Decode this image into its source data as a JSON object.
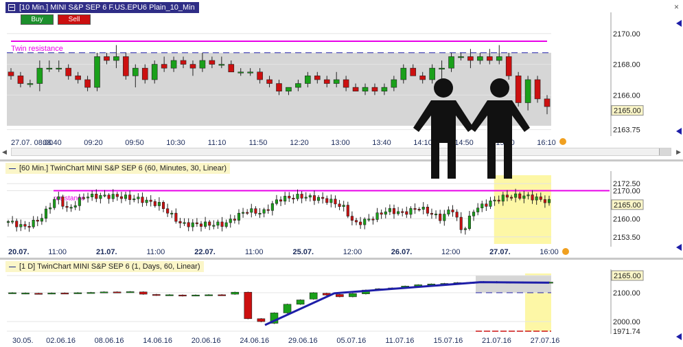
{
  "window": {
    "title": "[10 Min.] MINI S&P SEP 6   F.US.EPU6 Plain_10_Min",
    "buy_label": "Buy",
    "sell_label": "Sell",
    "close_glyph": "×"
  },
  "colors": {
    "bull": "#1aa01a",
    "bear": "#cc1010",
    "resistance": "#e800e8",
    "trendline": "#1e1ea8",
    "dashed": "#1e1ea8",
    "highlight": "#fdf7a6",
    "zone": "#d6d6d6"
  },
  "chart_data": [
    {
      "name": "pane-10min",
      "type": "candlestick",
      "ylim": [
        2163.6,
        2171.2
      ],
      "y_ticks": [
        2170.0,
        2168.0,
        2166.0,
        2163.75
      ],
      "y_tick_labels": [
        "2170.00",
        "2168.00",
        "2166.00",
        "2163.75"
      ],
      "current_price": "2165.00",
      "x_tick_labels": [
        "27.07. 08:00",
        "08:40",
        "09:20",
        "09:50",
        "10:30",
        "11:10",
        "11:50",
        "12:20",
        "13:00",
        "13:40",
        "14:10",
        "14:50",
        "15:30",
        "16:10"
      ],
      "annotations": [
        {
          "text": "Twin resistance",
          "y": 2169.5
        }
      ],
      "resistance_line": 2169.5,
      "dashed_line": 2168.75,
      "zone": [
        2164.0,
        2168.75
      ],
      "candles": [
        [
          2167.5,
          2167.75,
          2167.0,
          2167.25
        ],
        [
          2167.25,
          2167.5,
          2166.5,
          2166.75
        ],
        [
          2166.75,
          2167.0,
          2166.5,
          2166.75
        ],
        [
          2166.75,
          2168.25,
          2166.25,
          2167.75
        ],
        [
          2167.75,
          2168.25,
          2167.5,
          2167.75
        ],
        [
          2167.75,
          2168.25,
          2167.5,
          2167.75
        ],
        [
          2167.75,
          2168.0,
          2167.0,
          2167.25
        ],
        [
          2167.25,
          2167.5,
          2166.75,
          2167.0
        ],
        [
          2167.0,
          2167.25,
          2166.25,
          2166.5
        ],
        [
          2166.5,
          2168.75,
          2166.25,
          2168.5
        ],
        [
          2168.5,
          2168.75,
          2168.0,
          2168.25
        ],
        [
          2168.25,
          2169.25,
          2167.75,
          2168.5
        ],
        [
          2168.5,
          2168.75,
          2167.0,
          2167.25
        ],
        [
          2167.25,
          2168.0,
          2166.5,
          2167.75
        ],
        [
          2167.75,
          2168.0,
          2166.75,
          2167.0
        ],
        [
          2167.0,
          2168.25,
          2166.75,
          2168.0
        ],
        [
          2168.0,
          2168.5,
          2167.5,
          2167.75
        ],
        [
          2167.75,
          2168.5,
          2167.5,
          2168.25
        ],
        [
          2168.25,
          2168.5,
          2167.75,
          2168.0
        ],
        [
          2168.0,
          2168.25,
          2167.25,
          2167.75
        ],
        [
          2167.75,
          2168.75,
          2167.5,
          2168.25
        ],
        [
          2168.25,
          2168.5,
          2167.75,
          2168.0
        ],
        [
          2168.0,
          2168.5,
          2167.75,
          2168.0
        ],
        [
          2168.0,
          2168.25,
          2167.5,
          2167.5
        ],
        [
          2167.5,
          2167.75,
          2167.25,
          2167.5
        ],
        [
          2167.5,
          2167.75,
          2167.25,
          2167.5
        ],
        [
          2167.5,
          2167.75,
          2166.75,
          2167.0
        ],
        [
          2167.0,
          2167.25,
          2166.5,
          2166.75
        ],
        [
          2166.75,
          2167.0,
          2166.0,
          2166.25
        ],
        [
          2166.25,
          2166.5,
          2166.0,
          2166.5
        ],
        [
          2166.5,
          2167.0,
          2166.25,
          2166.75
        ],
        [
          2166.75,
          2167.5,
          2166.5,
          2167.25
        ],
        [
          2167.25,
          2167.5,
          2166.75,
          2167.0
        ],
        [
          2167.0,
          2167.25,
          2166.5,
          2166.75
        ],
        [
          2166.75,
          2167.5,
          2166.5,
          2167.0
        ],
        [
          2167.0,
          2167.25,
          2166.25,
          2166.5
        ],
        [
          2166.5,
          2166.75,
          2166.25,
          2166.25
        ],
        [
          2166.25,
          2166.75,
          2166.0,
          2166.5
        ],
        [
          2166.5,
          2166.75,
          2166.0,
          2166.25
        ],
        [
          2166.25,
          2166.75,
          2166.0,
          2166.5
        ],
        [
          2166.5,
          2167.25,
          2166.25,
          2167.0
        ],
        [
          2167.0,
          2168.0,
          2166.75,
          2167.75
        ],
        [
          2167.75,
          2168.0,
          2167.25,
          2167.25
        ],
        [
          2167.25,
          2167.5,
          2166.75,
          2167.0
        ],
        [
          2167.0,
          2168.0,
          2166.75,
          2167.75
        ],
        [
          2167.75,
          2168.25,
          2167.0,
          2167.75
        ],
        [
          2167.75,
          2168.75,
          2167.5,
          2168.5
        ],
        [
          2168.5,
          2168.75,
          2168.25,
          2168.5
        ],
        [
          2168.5,
          2169.0,
          2167.75,
          2168.25
        ],
        [
          2168.25,
          2168.75,
          2168.0,
          2168.5
        ],
        [
          2168.5,
          2169.0,
          2168.0,
          2168.25
        ],
        [
          2168.25,
          2169.25,
          2168.0,
          2168.5
        ],
        [
          2168.5,
          2168.75,
          2167.0,
          2167.25
        ],
        [
          2167.25,
          2167.5,
          2165.25,
          2165.5
        ],
        [
          2165.5,
          2167.25,
          2165.0,
          2167.0
        ],
        [
          2167.0,
          2167.25,
          2165.5,
          2165.75
        ],
        [
          2165.75,
          2166.0,
          2164.75,
          2165.25
        ]
      ]
    },
    {
      "name": "pane-60min",
      "type": "candlestick",
      "header": "[60 Min.]  TwinChart MINI S&P SEP 6  (60, Minutes, 30, Linear)",
      "ylim": [
        2151,
        2175.5
      ],
      "y_ticks": [
        2172.5,
        2170.0,
        2160.0,
        2153.5
      ],
      "y_tick_labels": [
        "2172.50",
        "2170.00",
        "2160.00",
        "2153.50"
      ],
      "current_price": "2165.00",
      "x_tick_labels": [
        "20.07.",
        "11:00",
        "21.07.",
        "11:00",
        "22.07.",
        "11:00",
        "25.07.",
        "12:00",
        "26.07.",
        "12:00",
        "27.07.",
        "16:00"
      ],
      "x_tick_bold": [
        true,
        false,
        true,
        false,
        true,
        false,
        true,
        false,
        true,
        false,
        true,
        false
      ],
      "annotations": [
        {
          "text": "resistance",
          "y": 2170
        }
      ],
      "resistance_line": 2170.0,
      "highlight_from": 0.895
    },
    {
      "name": "pane-1day",
      "type": "candlestick",
      "header": "[1 D]  TwinChart MINI S&P SEP 6  (1, Days, 60, Linear)",
      "y_ticks": [
        2165.0,
        2100.0,
        2000.0,
        1971.74
      ],
      "y_tick_labels": [
        "2165.00",
        "2100.00",
        "2000.00",
        "1971.74"
      ],
      "current_price": "2165.00",
      "x_tick_labels": [
        "30.05.",
        "02.06.16",
        "08.06.16",
        "14.06.16",
        "20.06.16",
        "24.06.16",
        "29.06.16",
        "05.07.16",
        "11.07.16",
        "15.07.16",
        "21.07.16",
        "27.07.16"
      ],
      "highlight_from": 0.952
    }
  ]
}
